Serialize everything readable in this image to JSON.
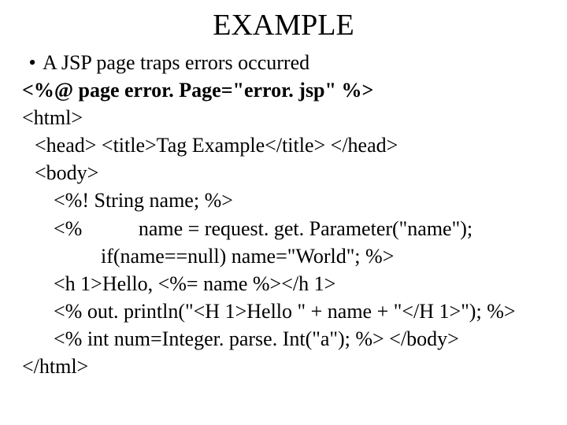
{
  "title": "EXAMPLE",
  "bullet": "A JSP page traps errors occurred",
  "lines": {
    "l1": "<%@ page error. Page=\"error. jsp\" %>",
    "l2": "<html>",
    "l3": "<head> <title>Tag Example</title> </head>",
    "l4": "<body>",
    "l5": "<%! String name; %>",
    "l6": "<%           name = request. get. Parameter(\"name\");",
    "l7": "if(name==null) name=\"World\"; %>",
    "l8": "<h 1>Hello, <%= name %></h 1>",
    "l9": "<% out. println(\"<H 1>Hello \" + name + \"</H 1>\"); %>",
    "l10": "<% int num=Integer. parse. Int(\"a\"); %> </body>",
    "l11": "</html>"
  }
}
